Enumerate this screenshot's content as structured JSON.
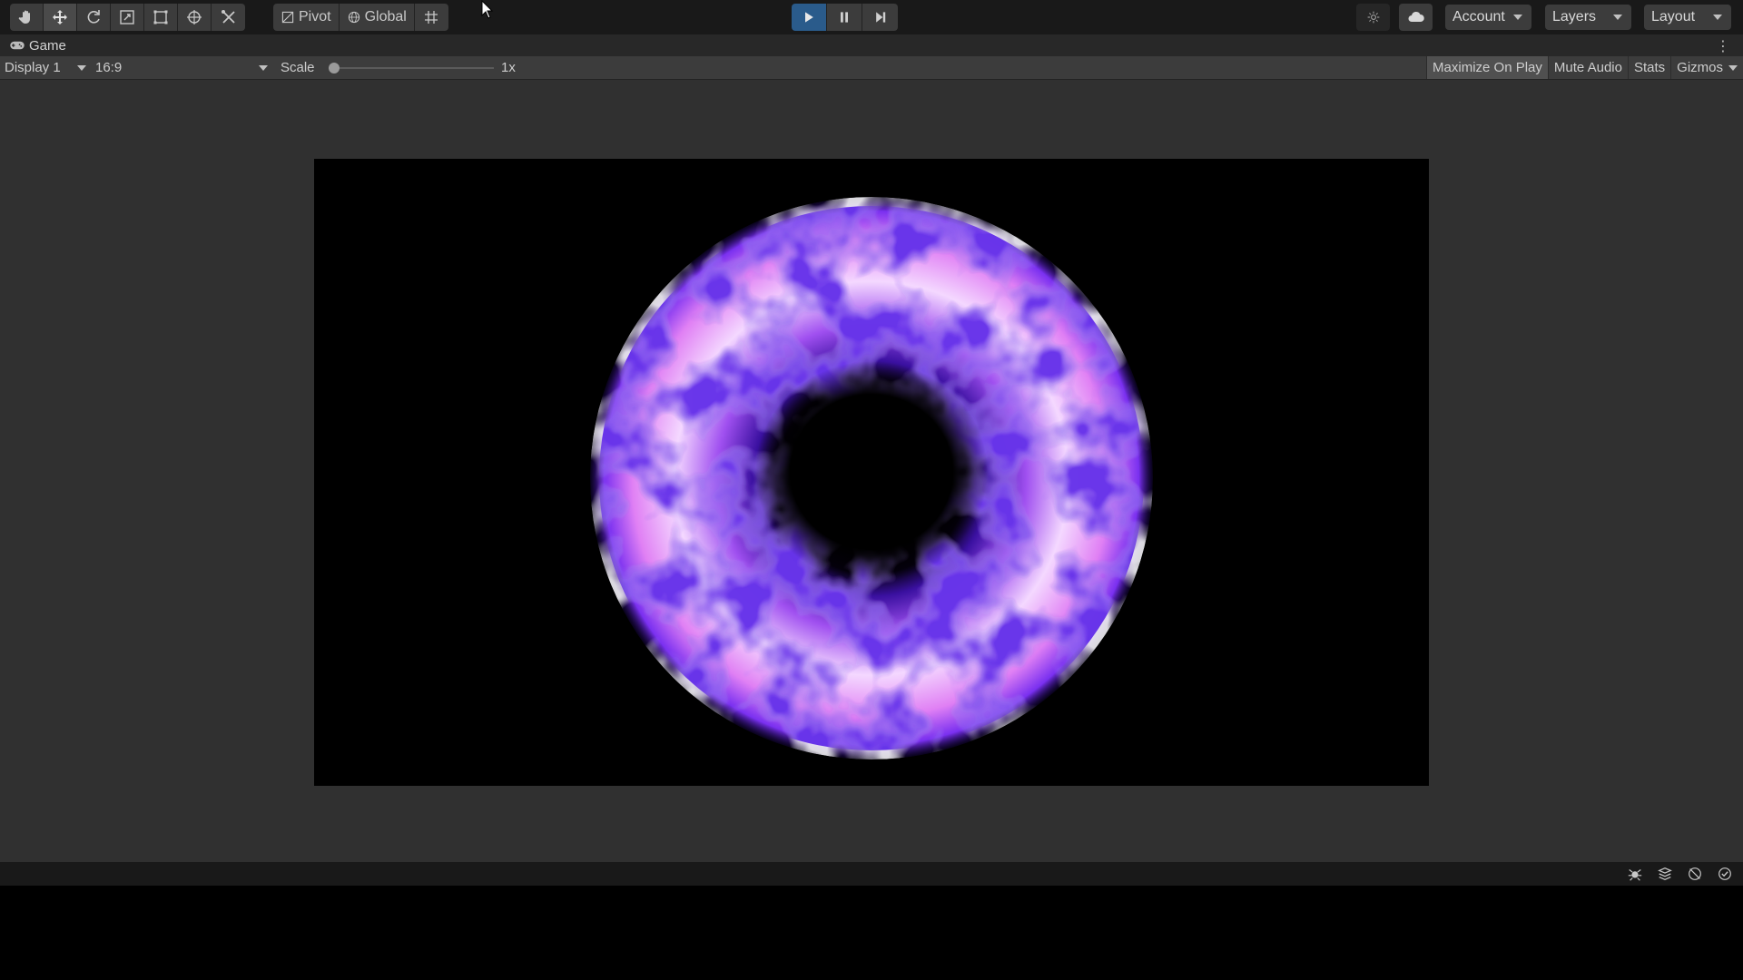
{
  "toolbar": {
    "tools": [
      {
        "icon": "hand-icon"
      },
      {
        "icon": "move-icon",
        "active": true
      },
      {
        "icon": "rotate-icon"
      },
      {
        "icon": "scale-icon"
      },
      {
        "icon": "rect-tool-icon"
      },
      {
        "icon": "transform-icon"
      },
      {
        "icon": "custom-tools-icon"
      }
    ],
    "pivot_label": "Pivot",
    "global_label": "Global",
    "account_label": "Account",
    "layers_label": "Layers",
    "layout_label": "Layout"
  },
  "tab": {
    "title": "Game"
  },
  "game_bar": {
    "display": "Display 1",
    "aspect": "16:9",
    "scale_label": "Scale",
    "scale_value": "1x",
    "scale_fraction": 0,
    "options": {
      "maximize": "Maximize On Play",
      "mute": "Mute Audio",
      "stats": "Stats",
      "gizmos": "Gizmos"
    }
  },
  "colors": {
    "accent_play": "#2a5b8b",
    "viewport_bg": "#303030",
    "panel_bg": "#3c3c3c",
    "sphere_white": "#ffffff",
    "sphere_pink": "#e070f0",
    "sphere_violet": "#6a2df0",
    "sphere_deep": "#2a0a80"
  }
}
